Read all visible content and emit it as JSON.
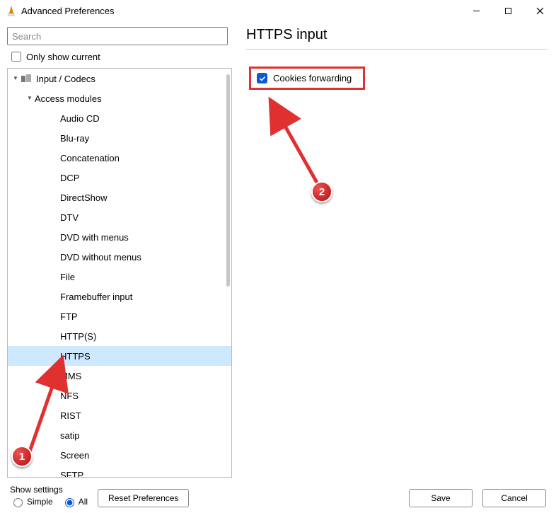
{
  "title": "Advanced Preferences",
  "search": {
    "placeholder": "Search"
  },
  "filter": {
    "label": "Only show current",
    "checked": false
  },
  "tree": {
    "root": {
      "label": "Input / Codecs"
    },
    "access": {
      "label": "Access modules"
    },
    "items": [
      {
        "label": "Audio CD"
      },
      {
        "label": "Blu-ray"
      },
      {
        "label": "Concatenation"
      },
      {
        "label": "DCP"
      },
      {
        "label": "DirectShow"
      },
      {
        "label": "DTV"
      },
      {
        "label": "DVD with menus"
      },
      {
        "label": "DVD without menus"
      },
      {
        "label": "File"
      },
      {
        "label": "Framebuffer input"
      },
      {
        "label": "FTP"
      },
      {
        "label": "HTTP(S)"
      },
      {
        "label": "HTTPS",
        "selected": true
      },
      {
        "label": "MMS"
      },
      {
        "label": "NFS"
      },
      {
        "label": "RIST"
      },
      {
        "label": "satip"
      },
      {
        "label": "Screen"
      },
      {
        "label": "SFTP"
      }
    ]
  },
  "panel": {
    "heading": "HTTPS input",
    "option": {
      "label": "Cookies forwarding",
      "checked": true
    }
  },
  "footer": {
    "show_settings_label": "Show settings",
    "simple_label": "Simple",
    "all_label": "All",
    "mode": "all",
    "reset_label": "Reset Preferences",
    "save_label": "Save",
    "cancel_label": "Cancel"
  },
  "annotations": {
    "marker1": "1",
    "marker2": "2"
  }
}
